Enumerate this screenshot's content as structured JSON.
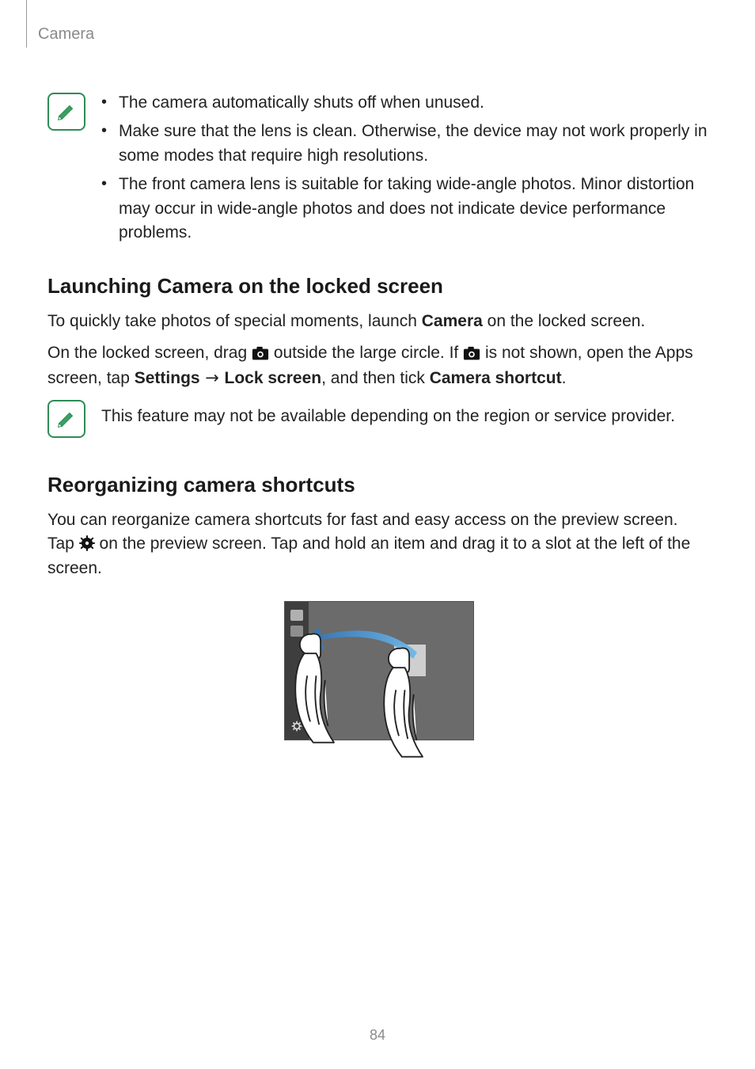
{
  "header": {
    "section": "Camera"
  },
  "page_number": "84",
  "note1": {
    "bullets": [
      "The camera automatically shuts off when unused.",
      "Make sure that the lens is clean. Otherwise, the device may not work properly in some modes that require high resolutions.",
      "The front camera lens is suitable for taking wide-angle photos. Minor distortion may occur in wide-angle photos and does not indicate device performance problems."
    ]
  },
  "section1": {
    "title": "Launching Camera on the locked screen",
    "p1_pre": "To quickly take photos of special moments, launch ",
    "p1_bold": "Camera",
    "p1_post": " on the locked screen.",
    "p2_a": "On the locked screen, drag ",
    "p2_b": " outside the large circle. If ",
    "p2_c": " is not shown, open the Apps screen, tap ",
    "p2_settings": "Settings",
    "p2_arrow": " → ",
    "p2_lock": "Lock screen",
    "p2_d": ", and then tick ",
    "p2_shortcut": "Camera shortcut",
    "p2_end": "."
  },
  "note2": {
    "text": "This feature may not be available depending on the region or service provider."
  },
  "section2": {
    "title": "Reorganizing camera shortcuts",
    "p1_a": "You can reorganize camera shortcuts for fast and easy access on the preview screen. Tap ",
    "p1_b": " on the preview screen. Tap and hold an item and drag it to a slot at the left of the screen."
  }
}
